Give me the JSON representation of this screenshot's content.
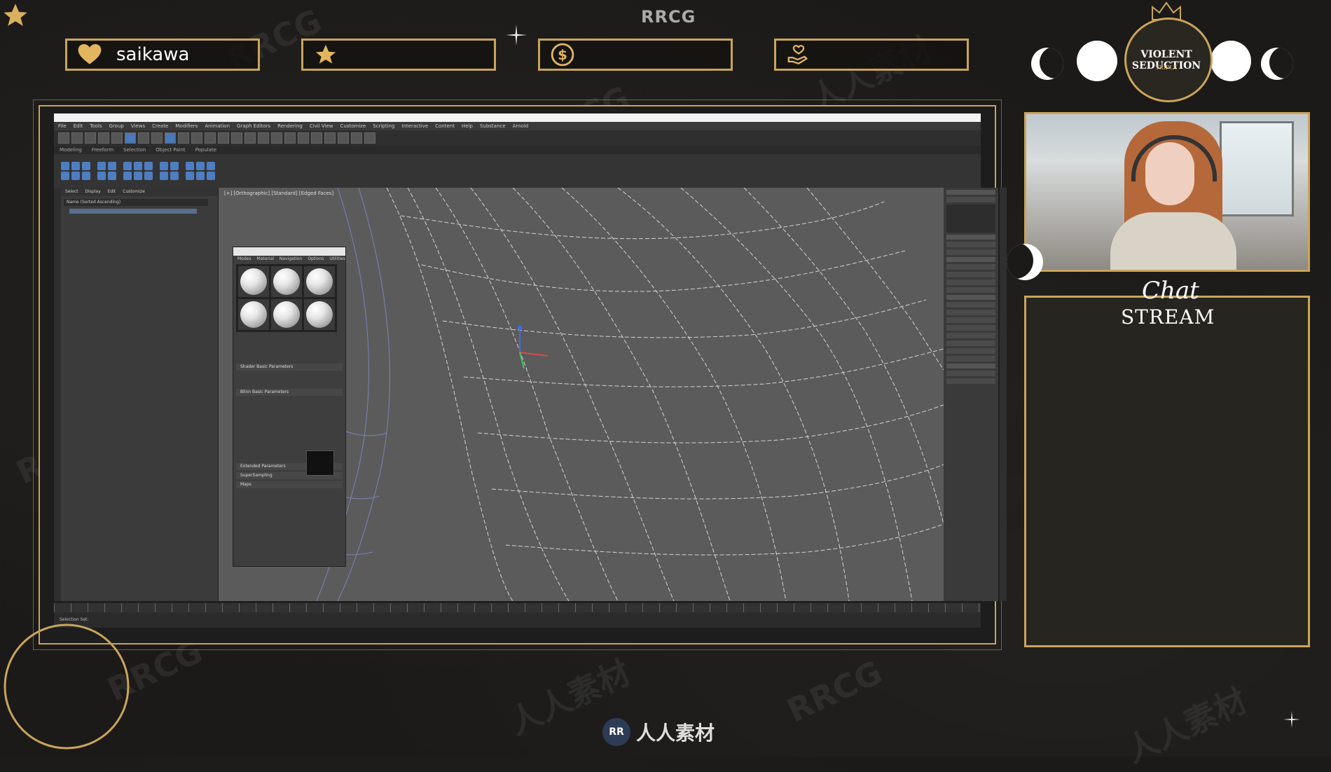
{
  "site_title": "RRCG",
  "alerts": [
    {
      "icon": "heart-icon",
      "text": "saikawa"
    },
    {
      "icon": "star-icon",
      "text": ""
    },
    {
      "icon": "dollar-icon",
      "text": ""
    },
    {
      "icon": "hand-heart-icon",
      "text": ""
    }
  ],
  "logo": {
    "name": "VIOLENT SEDUCTION",
    "sub": "TRIPLE"
  },
  "chat": {
    "script_title": "Chat",
    "title": "STREAM"
  },
  "app": {
    "menu": [
      "File",
      "Edit",
      "Tools",
      "Group",
      "Views",
      "Create",
      "Modifiers",
      "Animation",
      "Graph Editors",
      "Rendering",
      "Civil View",
      "Customize",
      "Scripting",
      "Interactive",
      "Content",
      "Help",
      "Substance",
      "Arnold"
    ],
    "ribbon_tabs": [
      "Modeling",
      "Freeform",
      "Selection",
      "Object Paint",
      "Populate"
    ],
    "scene_tabs": [
      "Select",
      "Display",
      "Edit",
      "Customize"
    ],
    "scene_header": "Name (Sorted Ascending)",
    "viewport_label": "[+] [Orthographic] [Standard] [Edged Faces]",
    "material_editor": {
      "menu": [
        "Modes",
        "Material",
        "Navigation",
        "Options",
        "Utilities"
      ],
      "rollouts": [
        "Shader Basic Parameters",
        "Blinn Basic Parameters",
        "Extended Parameters",
        "SuperSampling",
        "Maps"
      ]
    },
    "status": "Selection Set:"
  },
  "bottom_brand": "人人素材",
  "watermarks": [
    "RRCG",
    "人人素材"
  ],
  "colors": {
    "gold": "#c9a45c",
    "bg": "#1b1a18"
  }
}
